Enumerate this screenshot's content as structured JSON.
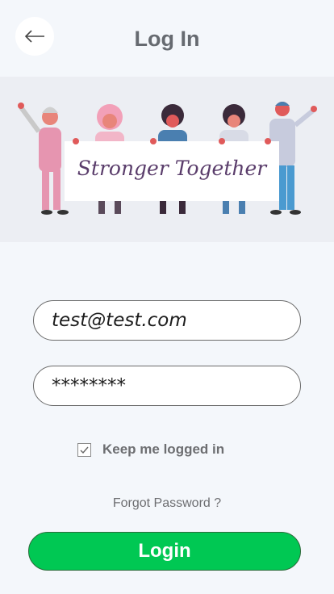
{
  "header": {
    "back_icon": "arrow-left-icon",
    "title": "Log In"
  },
  "banner": {
    "sign_text": "Stronger Together"
  },
  "form": {
    "email_value": "test@test.com",
    "password_value": "********",
    "keep_logged_in_label": "Keep me logged in",
    "keep_logged_in_checked": true,
    "forgot_password_label": "Forgot Password ?",
    "login_label": "Login"
  },
  "colors": {
    "background": "#f4f7fb",
    "banner_background": "#eceef3",
    "login_button": "#00c853",
    "text_gray": "#6d6e71"
  }
}
